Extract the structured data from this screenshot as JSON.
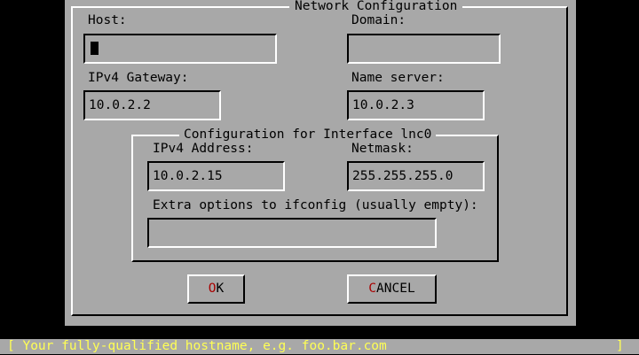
{
  "dialog": {
    "title": "Network Configuration"
  },
  "host": {
    "label": "Host:",
    "value": ""
  },
  "domain": {
    "label": "Domain:",
    "value": ""
  },
  "gateway": {
    "label": "IPv4 Gateway:",
    "value": "10.0.2.2"
  },
  "nameserver": {
    "label": "Name server:",
    "value": "10.0.2.3"
  },
  "interface_group": {
    "title": "Configuration for Interface lnc0",
    "ipv4_label": "IPv4 Address:",
    "ipv4_value": "10.0.2.15",
    "netmask_label": "Netmask:",
    "netmask_value": "255.255.255.0",
    "extra_label": "Extra options to ifconfig (usually empty):",
    "extra_value": ""
  },
  "buttons": {
    "ok": {
      "hotkey": "O",
      "rest": "K"
    },
    "cancel": {
      "hotkey": "C",
      "rest": "ANCEL"
    }
  },
  "status_bar": {
    "left": "[ Your fully-qualified hostname, e.g. foo.bar.com",
    "right": "]"
  },
  "colors": {
    "screen_bg": "#000000",
    "dialog_bg": "#a8a8a8",
    "hotkey": "#a80000",
    "status_text": "#ffff54"
  }
}
